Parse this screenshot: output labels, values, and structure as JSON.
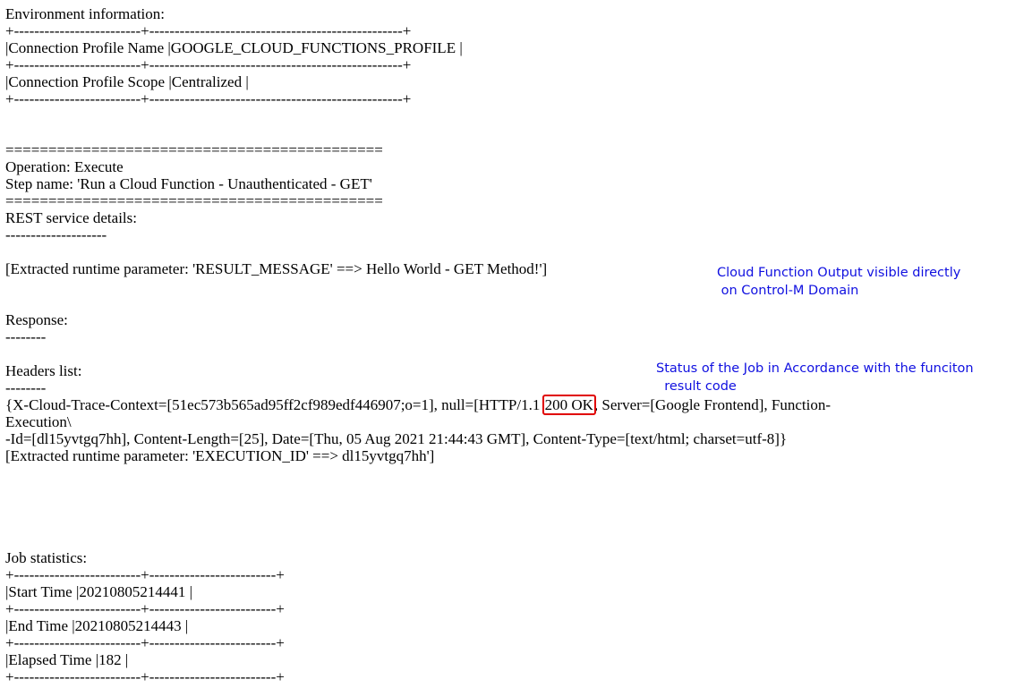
{
  "env": {
    "title": "Environment information:",
    "border": "+-------------------------+--------------------------------------------------+",
    "rows": [
      "|Connection Profile Name |GOOGLE_CLOUD_FUNCTIONS_PROFILE |",
      "|Connection Profile Scope |Centralized |"
    ]
  },
  "operation": {
    "separator": "============================================",
    "operation": "Operation: Execute",
    "step": "Step name: 'Run a Cloud Function - Unauthenticated - GET'",
    "rest_title": "REST service details:",
    "rest_dash": "--------------------",
    "extracted_result": "[Extracted runtime parameter: 'RESULT_MESSAGE' ==> Hello World - GET Method!']",
    "response_title": "Response:",
    "response_dash": "--------",
    "headers_title": "Headers list:",
    "headers_dash": "--------",
    "headers_line1_pre": "{X-Cloud-Trace-Context=[51ec573b565ad95ff2cf989edf446907;o=1], null=[HTTP/1.1 ",
    "headers_status": "200 OK",
    "headers_line1_post": ", Server=[Google Frontend], Function-",
    "headers_line2": "Execution\\",
    "headers_line3": "-Id=[dl15yvtgq7hh], Content-Length=[25], Date=[Thu, 05 Aug 2021 21:44:43 GMT], Content-Type=[text/html; charset=utf-8]}",
    "extracted_exec": "[Extracted runtime parameter: 'EXECUTION_ID' ==> dl15yvtgq7hh']"
  },
  "stats": {
    "title": "Job statistics:",
    "border": "+-------------------------+-------------------------+",
    "rows": [
      "|Start Time |20210805214441 |",
      "|End Time |20210805214443 |",
      "|Elapsed Time |182 |"
    ]
  },
  "annotations": {
    "output_note": "Cloud Function Output visible directly\n on Control-M Domain",
    "status_note": "Status of the Job in Accordance with the funciton\n  result code",
    "note_color": "#1010e0",
    "highlight_color": "#e00000"
  }
}
